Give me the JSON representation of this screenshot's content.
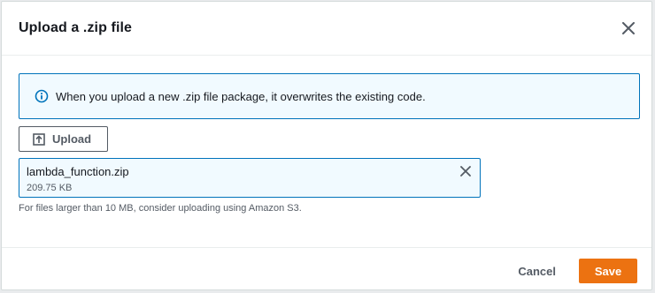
{
  "modal": {
    "title": "Upload a .zip file"
  },
  "alert": {
    "icon": "info-icon",
    "message": "When you upload a new .zip file package, it overwrites the existing code."
  },
  "upload": {
    "label": "Upload",
    "icon": "upload-icon"
  },
  "file": {
    "name": "lambda_function.zip",
    "size": "209.75 KB"
  },
  "constraint": "For files larger than 10 MB, consider uploading using Amazon S3.",
  "footer": {
    "cancel_label": "Cancel",
    "save_label": "Save"
  },
  "colors": {
    "primary": "#ec7211",
    "info_border": "#0073bb",
    "info_background": "#f1faff"
  }
}
